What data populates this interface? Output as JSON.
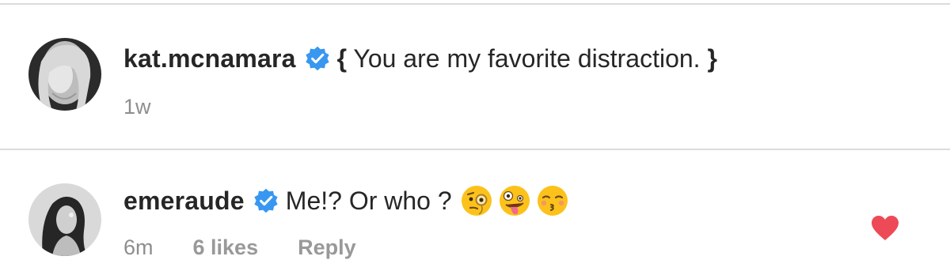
{
  "comments": [
    {
      "username": "kat.mcnamara",
      "verified": true,
      "text_open": "{",
      "text": " You are my favorite distraction. ",
      "text_close": "}",
      "time": "1w"
    },
    {
      "username": "emeraude",
      "verified": true,
      "text": "Me!? Or who ?",
      "emojis": [
        "face-with-monocle",
        "zany-face",
        "kissing-face-with-closed-eyes"
      ],
      "time": "6m",
      "likes": "6 likes",
      "reply_label": "Reply",
      "liked": true
    }
  ],
  "colors": {
    "verified": "#3897f0",
    "heart": "#ed4956",
    "meta": "#8e8e8e",
    "divider": "#dbdbdb"
  }
}
